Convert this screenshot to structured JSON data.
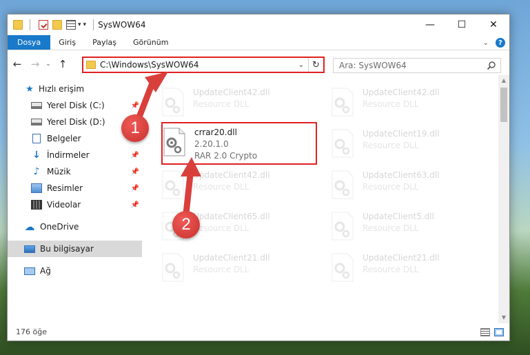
{
  "window": {
    "title": "SysWOW64",
    "minimize": "—",
    "maximize": "☐",
    "close": "✕"
  },
  "ribbon": {
    "tabs": [
      "Dosya",
      "Giriş",
      "Paylaş",
      "Görünüm"
    ],
    "expand": "⌄",
    "help": "?"
  },
  "navigation": {
    "back": "←",
    "forward": "→",
    "recent": "⌄",
    "up": "↑",
    "path": "C:\\Windows\\SysWOW64",
    "dropdown": "⌄",
    "refresh": "↻",
    "search_placeholder": "Ara: SysWOW64"
  },
  "sidebar": {
    "items": [
      {
        "label": "Hızlı erişim",
        "icon": "star-icon"
      },
      {
        "label": "Yerel Disk (C:)",
        "icon": "drive-icon",
        "pinned": true
      },
      {
        "label": "Yerel Disk (D:)",
        "icon": "drive-icon"
      },
      {
        "label": "Belgeler",
        "icon": "documents-icon",
        "pinned": true
      },
      {
        "label": "İndirmeler",
        "icon": "downloads-icon",
        "pinned": true
      },
      {
        "label": "Müzik",
        "icon": "music-icon",
        "pinned": true
      },
      {
        "label": "Resimler",
        "icon": "pictures-icon",
        "pinned": true
      },
      {
        "label": "Videolar",
        "icon": "videos-icon",
        "pinned": true
      },
      {
        "label": "OneDrive",
        "icon": "cloud-icon"
      },
      {
        "label": "Bu bilgisayar",
        "icon": "computer-icon",
        "selected": true
      },
      {
        "label": "Ağ",
        "icon": "network-icon"
      }
    ],
    "pin_glyph": "📌"
  },
  "files": [
    {
      "name": "UpdateClient42.dll",
      "type": "Resource DLL",
      "faded": true
    },
    {
      "name": "UpdateClient42.dll",
      "type": "Resource DLL",
      "faded": true
    },
    {
      "name": "crrar20.dll",
      "version": "2.20.1.0",
      "type": "RAR 2.0 Crypto",
      "faded": false
    },
    {
      "name": "UpdateClient19.dll",
      "type": "Resource DLL",
      "faded": true
    },
    {
      "name": "UpdateClient42.dll",
      "type": "Resource DLL",
      "faded": true
    },
    {
      "name": "UpdateClient63.dll",
      "type": "Resource DLL",
      "faded": true
    },
    {
      "name": "UpdateClient65.dll",
      "type": "Resource DLL",
      "faded": true
    },
    {
      "name": "UpdateClient5.dll",
      "type": "Resource DLL",
      "faded": true
    },
    {
      "name": "UpdateClient21.dll",
      "type": "Resource DLL",
      "faded": true
    },
    {
      "name": "UpdateClient21.dll",
      "type": "Resource DLL",
      "faded": true
    }
  ],
  "status": {
    "count": "176 öğe"
  },
  "markers": [
    "1",
    "2"
  ],
  "colors": {
    "accent": "#1979ca",
    "highlight": "#e02020",
    "marker": "#d9403c"
  }
}
